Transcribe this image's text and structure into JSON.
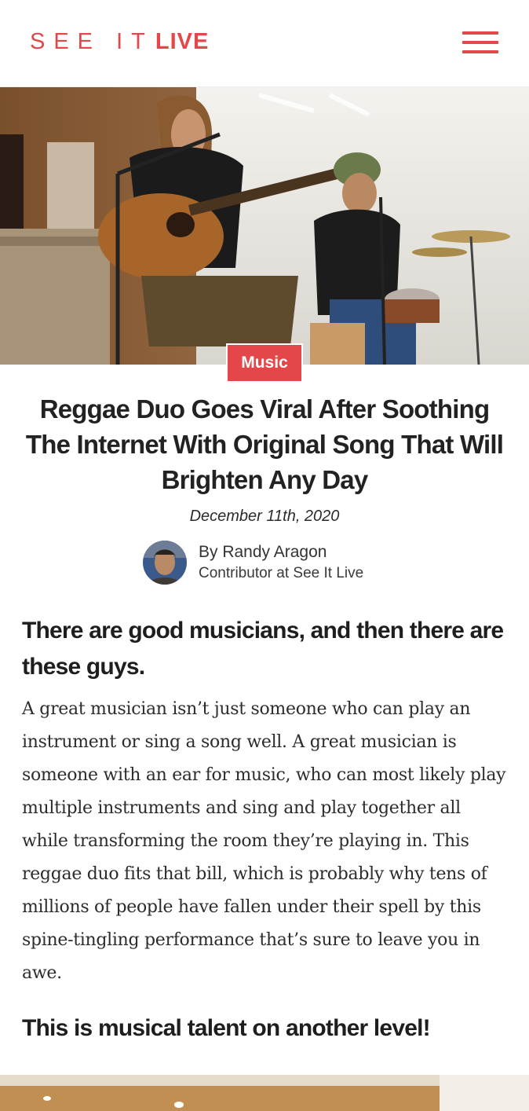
{
  "site": {
    "logo_part1": "SEE IT",
    "logo_part2": "LIVE",
    "brand_color": "#e4474a"
  },
  "header": {
    "menu_icon": "hamburger-menu-icon"
  },
  "article": {
    "category": "Music",
    "title": "Reggae Duo Goes Viral After Soothing The Internet With Original Song That Will Brighten Any Day",
    "date": "December 11th, 2020",
    "author": {
      "name": "By Randy Aragon",
      "role": "Contributor at See It Live"
    },
    "subheading": "There are good musicians, and then there are these guys.",
    "paragraph": "A great musician isn’t just someone who can play an instrument or sing a song well. A great musician is someone with an ear for music, who can most likely play multiple instruments and sing and play together all while transforming the room they’re playing in. This reggae duo fits that bill, which is probably why tens of millions of people have fallen under their spell by this spine-tingling performance that’s sure to leave you in awe.",
    "subheading2": "This is musical talent on another level!"
  }
}
